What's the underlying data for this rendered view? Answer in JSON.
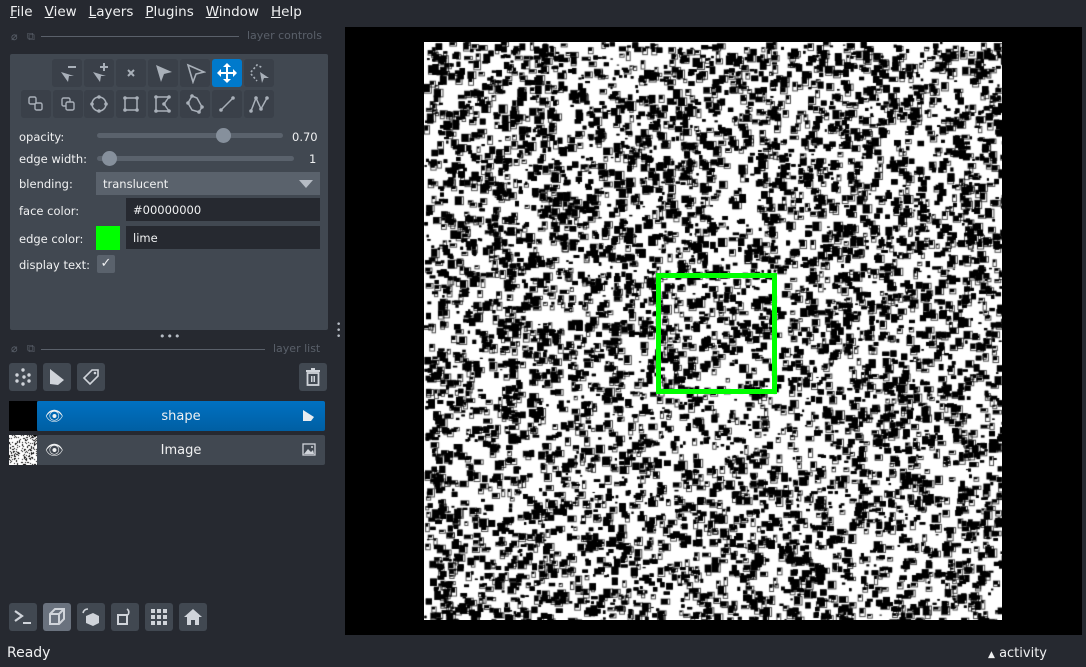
{
  "menu": [
    {
      "u": "F",
      "rest": "ile"
    },
    {
      "u": "V",
      "rest": "iew"
    },
    {
      "u": "L",
      "rest": "ayers"
    },
    {
      "u": "P",
      "rest": "lugins"
    },
    {
      "u": "W",
      "rest": "indow"
    },
    {
      "u": "H",
      "rest": "elp"
    }
  ],
  "layer_controls": {
    "title": "layer controls",
    "opacity_label": "opacity:",
    "opacity_value": "0.70",
    "opacity": 0.7,
    "edge_width_label": "edge width:",
    "edge_width_value": "1",
    "blending_label": "blending:",
    "blending_value": "translucent",
    "face_color_label": "face color:",
    "face_color_value": "#00000000",
    "edge_color_label": "edge color:",
    "edge_color_value": "lime",
    "edge_color_hex": "#00ff00",
    "display_text_label": "display text:",
    "display_text_checked": true,
    "active_tool": "move"
  },
  "layer_list": {
    "title": "layer list",
    "layers": [
      {
        "name": "shape",
        "selected": true,
        "visible": true,
        "type": "shapes"
      },
      {
        "name": "Image",
        "selected": false,
        "visible": true,
        "type": "image"
      }
    ]
  },
  "status": {
    "text": "Ready",
    "activity": "activity"
  },
  "colors": {
    "accent": "#007acc",
    "selected_layer": "#0069b3",
    "lime": "#00ff00"
  }
}
